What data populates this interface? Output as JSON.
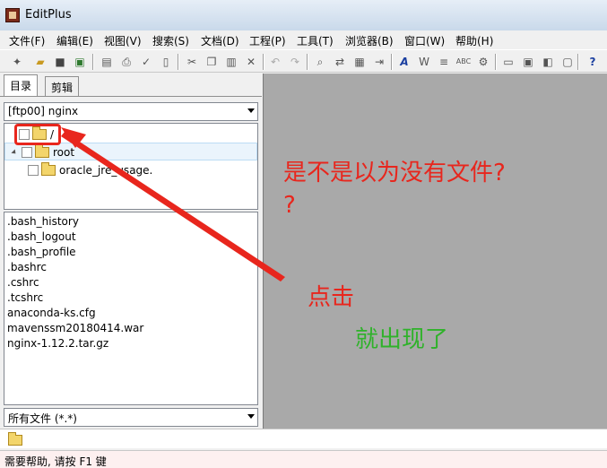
{
  "window": {
    "title": "EditPlus"
  },
  "menu": [
    {
      "label": "文件(F)"
    },
    {
      "label": "编辑(E)"
    },
    {
      "label": "视图(V)"
    },
    {
      "label": "搜索(S)"
    },
    {
      "label": "文档(D)"
    },
    {
      "label": "工程(P)"
    },
    {
      "label": "工具(T)"
    },
    {
      "label": "浏览器(B)"
    },
    {
      "label": "窗口(W)"
    },
    {
      "label": "帮助(H)"
    }
  ],
  "toolbar": {
    "icons": [
      "new-file-icon",
      "open-folder-icon",
      "save-icon",
      "save-all-icon",
      "print-preview-icon",
      "print-icon",
      "spell-check-icon",
      "page-setup-icon",
      "cut-icon",
      "copy-icon",
      "paste-icon",
      "delete-icon",
      "undo-icon",
      "redo-icon",
      "find-icon",
      "replace-icon",
      "find-in-files-icon",
      "goto-icon",
      "font-icon",
      "word-wrap-icon",
      "ruler-icon",
      "hex-icon",
      "settings-icon",
      "view-1-icon",
      "view-2-icon",
      "view-3-icon",
      "view-4-icon",
      "help-icon"
    ]
  },
  "sidebar": {
    "tabs": [
      {
        "label": "目录"
      },
      {
        "label": "剪辑"
      }
    ],
    "server_combo": {
      "value": "[ftp00] nginx"
    },
    "tree": [
      {
        "label": "/"
      },
      {
        "label": "root"
      },
      {
        "label": "oracle_jre_usage."
      }
    ],
    "files": [
      ".bash_history",
      ".bash_logout",
      ".bash_profile",
      ".bashrc",
      ".cshrc",
      ".tcshrc",
      "anaconda-ks.cfg",
      "mavenssm20180414.war",
      "nginx-1.12.2.tar.gz"
    ],
    "filter_combo": {
      "value": "所有文件 (*.*)"
    }
  },
  "statusbar": {
    "text": "需要帮助, 请按 F1 键"
  },
  "annotations": {
    "question": "是不是以为没有文件?",
    "question_mark": "?",
    "click": "点击",
    "appeared": "就出现了",
    "colors": {
      "red": "#e8261d",
      "green": "#2fb22a"
    }
  }
}
